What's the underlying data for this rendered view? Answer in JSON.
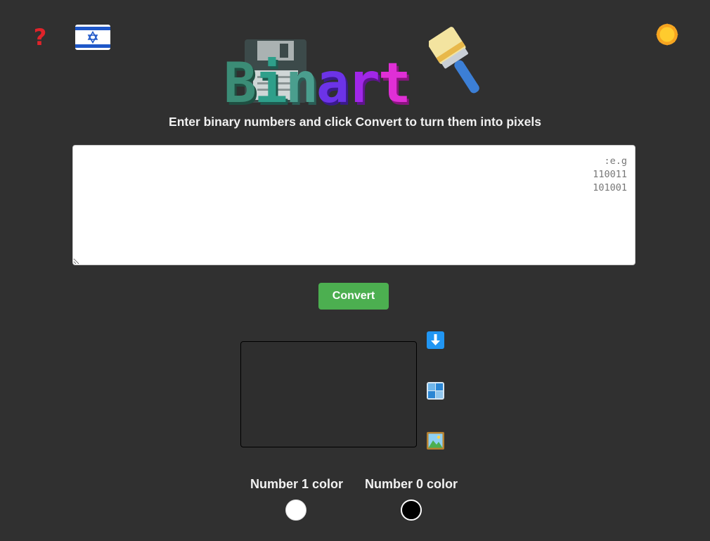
{
  "header": {
    "help_label": "?",
    "theme_icon": "sun-icon",
    "language_icon": "israel-flag-icon"
  },
  "logo": {
    "text": "Binart",
    "letters": [
      "B",
      "i",
      "n",
      "a",
      "r",
      "t"
    ],
    "icons": [
      "floppy-disk-icon",
      "paintbrush-icon"
    ]
  },
  "subtitle": "Enter binary numbers and click Convert to turn them into pixels",
  "input": {
    "value": "",
    "placeholder": "e.g:\n110011\n101001"
  },
  "convert_label": "Convert",
  "canvas_actions": {
    "download_icon": "download-icon",
    "grid_icon": "grid-icon",
    "image_icon": "image-icon"
  },
  "colors": {
    "one_label": "Number 1 color",
    "zero_label": "Number 0 color",
    "one_value": "#ffffff",
    "zero_value": "#000000"
  },
  "accent": {
    "convert_button": "#4caf50",
    "background": "#303030",
    "help_icon": "#e0232a"
  }
}
